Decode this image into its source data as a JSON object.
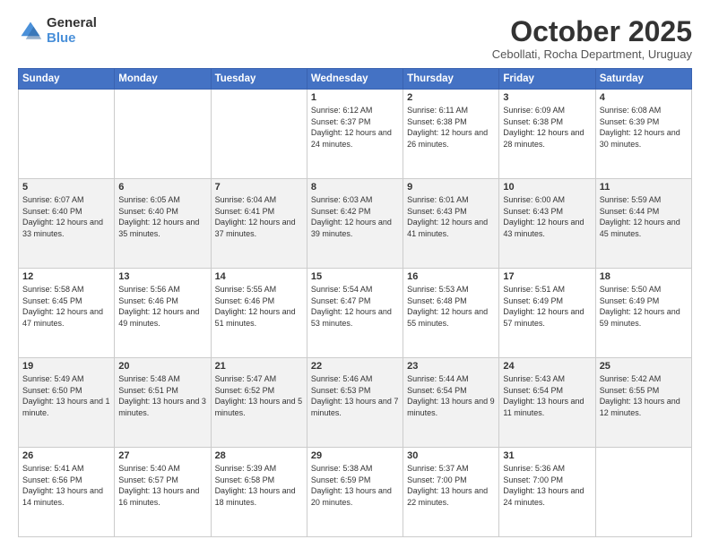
{
  "logo": {
    "general": "General",
    "blue": "Blue"
  },
  "header": {
    "title": "October 2025",
    "subtitle": "Cebollati, Rocha Department, Uruguay"
  },
  "days_of_week": [
    "Sunday",
    "Monday",
    "Tuesday",
    "Wednesday",
    "Thursday",
    "Friday",
    "Saturday"
  ],
  "weeks": [
    [
      {
        "day": "",
        "info": ""
      },
      {
        "day": "",
        "info": ""
      },
      {
        "day": "",
        "info": ""
      },
      {
        "day": "1",
        "info": "Sunrise: 6:12 AM\nSunset: 6:37 PM\nDaylight: 12 hours\nand 24 minutes."
      },
      {
        "day": "2",
        "info": "Sunrise: 6:11 AM\nSunset: 6:38 PM\nDaylight: 12 hours\nand 26 minutes."
      },
      {
        "day": "3",
        "info": "Sunrise: 6:09 AM\nSunset: 6:38 PM\nDaylight: 12 hours\nand 28 minutes."
      },
      {
        "day": "4",
        "info": "Sunrise: 6:08 AM\nSunset: 6:39 PM\nDaylight: 12 hours\nand 30 minutes."
      }
    ],
    [
      {
        "day": "5",
        "info": "Sunrise: 6:07 AM\nSunset: 6:40 PM\nDaylight: 12 hours\nand 33 minutes."
      },
      {
        "day": "6",
        "info": "Sunrise: 6:05 AM\nSunset: 6:40 PM\nDaylight: 12 hours\nand 35 minutes."
      },
      {
        "day": "7",
        "info": "Sunrise: 6:04 AM\nSunset: 6:41 PM\nDaylight: 12 hours\nand 37 minutes."
      },
      {
        "day": "8",
        "info": "Sunrise: 6:03 AM\nSunset: 6:42 PM\nDaylight: 12 hours\nand 39 minutes."
      },
      {
        "day": "9",
        "info": "Sunrise: 6:01 AM\nSunset: 6:43 PM\nDaylight: 12 hours\nand 41 minutes."
      },
      {
        "day": "10",
        "info": "Sunrise: 6:00 AM\nSunset: 6:43 PM\nDaylight: 12 hours\nand 43 minutes."
      },
      {
        "day": "11",
        "info": "Sunrise: 5:59 AM\nSunset: 6:44 PM\nDaylight: 12 hours\nand 45 minutes."
      }
    ],
    [
      {
        "day": "12",
        "info": "Sunrise: 5:58 AM\nSunset: 6:45 PM\nDaylight: 12 hours\nand 47 minutes."
      },
      {
        "day": "13",
        "info": "Sunrise: 5:56 AM\nSunset: 6:46 PM\nDaylight: 12 hours\nand 49 minutes."
      },
      {
        "day": "14",
        "info": "Sunrise: 5:55 AM\nSunset: 6:46 PM\nDaylight: 12 hours\nand 51 minutes."
      },
      {
        "day": "15",
        "info": "Sunrise: 5:54 AM\nSunset: 6:47 PM\nDaylight: 12 hours\nand 53 minutes."
      },
      {
        "day": "16",
        "info": "Sunrise: 5:53 AM\nSunset: 6:48 PM\nDaylight: 12 hours\nand 55 minutes."
      },
      {
        "day": "17",
        "info": "Sunrise: 5:51 AM\nSunset: 6:49 PM\nDaylight: 12 hours\nand 57 minutes."
      },
      {
        "day": "18",
        "info": "Sunrise: 5:50 AM\nSunset: 6:49 PM\nDaylight: 12 hours\nand 59 minutes."
      }
    ],
    [
      {
        "day": "19",
        "info": "Sunrise: 5:49 AM\nSunset: 6:50 PM\nDaylight: 13 hours\nand 1 minute."
      },
      {
        "day": "20",
        "info": "Sunrise: 5:48 AM\nSunset: 6:51 PM\nDaylight: 13 hours\nand 3 minutes."
      },
      {
        "day": "21",
        "info": "Sunrise: 5:47 AM\nSunset: 6:52 PM\nDaylight: 13 hours\nand 5 minutes."
      },
      {
        "day": "22",
        "info": "Sunrise: 5:46 AM\nSunset: 6:53 PM\nDaylight: 13 hours\nand 7 minutes."
      },
      {
        "day": "23",
        "info": "Sunrise: 5:44 AM\nSunset: 6:54 PM\nDaylight: 13 hours\nand 9 minutes."
      },
      {
        "day": "24",
        "info": "Sunrise: 5:43 AM\nSunset: 6:54 PM\nDaylight: 13 hours\nand 11 minutes."
      },
      {
        "day": "25",
        "info": "Sunrise: 5:42 AM\nSunset: 6:55 PM\nDaylight: 13 hours\nand 12 minutes."
      }
    ],
    [
      {
        "day": "26",
        "info": "Sunrise: 5:41 AM\nSunset: 6:56 PM\nDaylight: 13 hours\nand 14 minutes."
      },
      {
        "day": "27",
        "info": "Sunrise: 5:40 AM\nSunset: 6:57 PM\nDaylight: 13 hours\nand 16 minutes."
      },
      {
        "day": "28",
        "info": "Sunrise: 5:39 AM\nSunset: 6:58 PM\nDaylight: 13 hours\nand 18 minutes."
      },
      {
        "day": "29",
        "info": "Sunrise: 5:38 AM\nSunset: 6:59 PM\nDaylight: 13 hours\nand 20 minutes."
      },
      {
        "day": "30",
        "info": "Sunrise: 5:37 AM\nSunset: 7:00 PM\nDaylight: 13 hours\nand 22 minutes."
      },
      {
        "day": "31",
        "info": "Sunrise: 5:36 AM\nSunset: 7:00 PM\nDaylight: 13 hours\nand 24 minutes."
      },
      {
        "day": "",
        "info": ""
      }
    ]
  ]
}
